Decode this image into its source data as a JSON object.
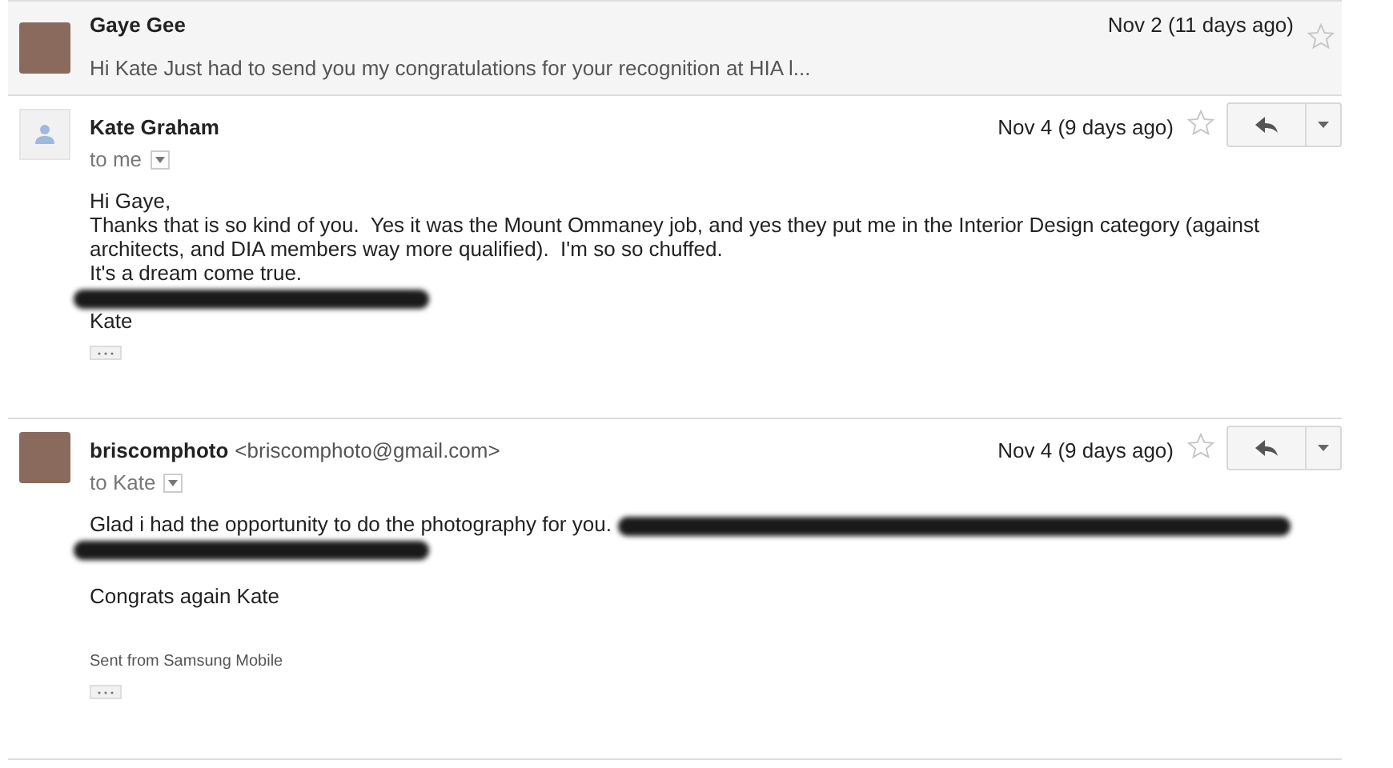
{
  "messages": [
    {
      "kind": "collapsed",
      "sender": "Gaye Gee",
      "photo_avatar": true,
      "date": "Nov 2 (11 days ago)",
      "starred": false,
      "snippet": "Hi Kate Just had to send you my congratulations for your recognition at HIA l..."
    },
    {
      "kind": "expanded",
      "sender": "Kate Graham",
      "photo_avatar": false,
      "date": "Nov 4 (9 days ago)",
      "starred": false,
      "recipient": "to me",
      "lines": [
        [
          {
            "kind": "text",
            "text": "Hi Gaye,"
          }
        ],
        [
          {
            "kind": "text",
            "text": "Thanks that is so kind of you.  Yes it was the Mount Ommaney job, and yes they put me in the Interior Design category (against architects, and DIA members way more qualified).  I'm so so chuffed."
          }
        ],
        [
          {
            "kind": "text",
            "text": "It's a dream come true."
          }
        ],
        [
          {
            "kind": "redacted"
          }
        ],
        [
          {
            "kind": "text",
            "text": "Kate"
          }
        ]
      ]
    },
    {
      "kind": "expanded",
      "sender": "briscomphoto",
      "address": "<briscomphoto@gmail.com>",
      "photo_avatar": true,
      "date": "Nov 4 (9 days ago)",
      "starred": false,
      "recipient": "to Kate",
      "lines": [
        [
          {
            "kind": "text",
            "text": "Glad i had the opportunity to do the photography for you."
          },
          {
            "kind": "redacted_long"
          }
        ],
        [
          {
            "kind": "redacted"
          }
        ],
        [
          {
            "kind": "blank"
          }
        ],
        [
          {
            "kind": "text",
            "text": "Congrats again Kate"
          }
        ]
      ],
      "signature": "Sent from Samsung Mobile"
    }
  ]
}
